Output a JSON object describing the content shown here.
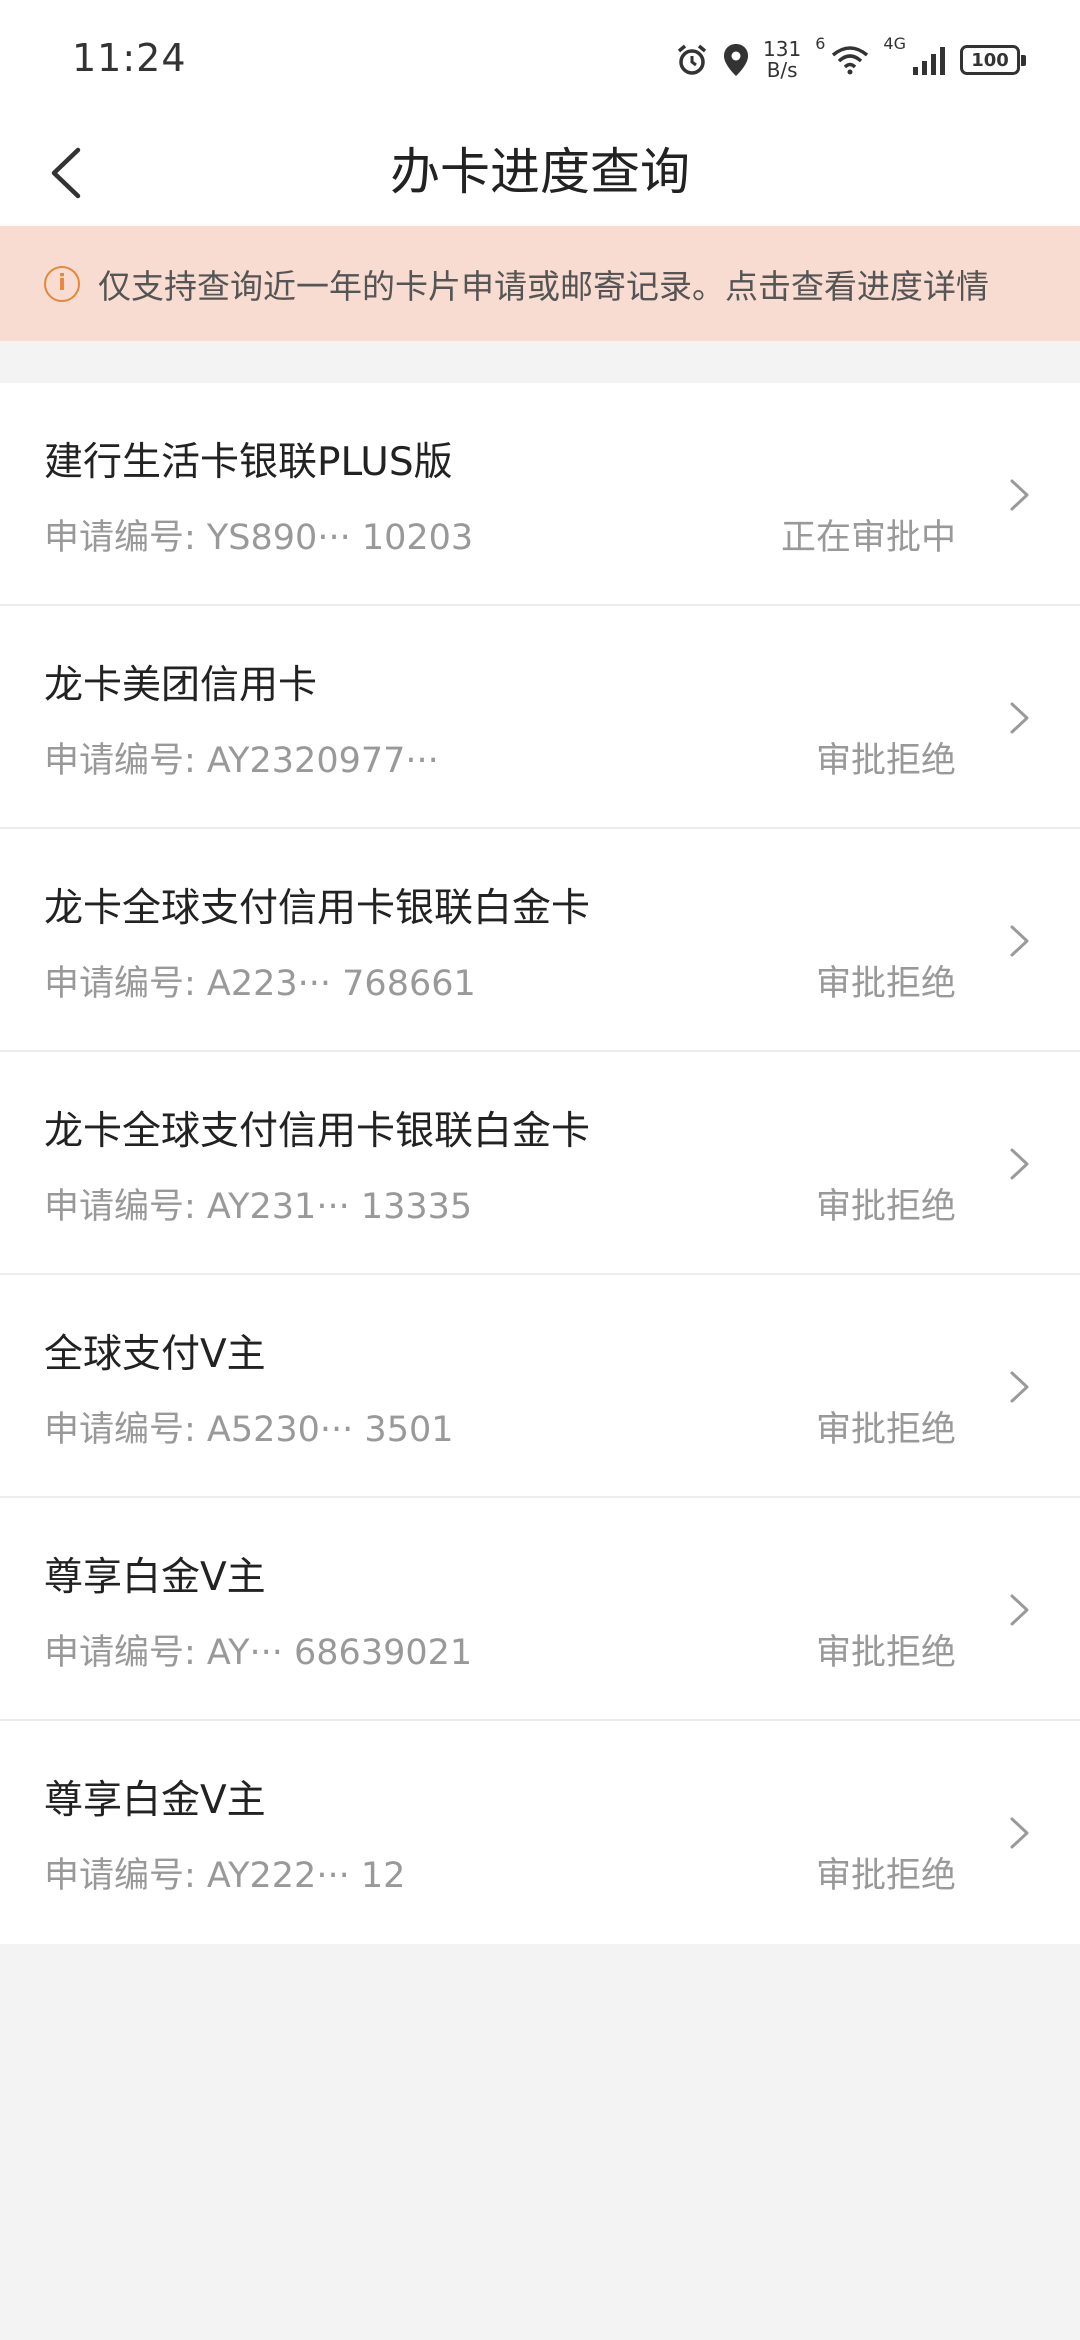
{
  "status_bar": {
    "time": "11:24",
    "net_speed_value": "131",
    "net_speed_unit": "B/s",
    "wifi_label": "6",
    "signal_label": "4G",
    "battery": "100"
  },
  "nav": {
    "title": "办卡进度查询"
  },
  "notice": {
    "icon": "info-icon",
    "icon_glyph": "i",
    "text": "仅支持查询近一年的卡片申请或邮寄记录。点击查看进度详情",
    "color": "#e7873a"
  },
  "applications": [
    {
      "title": "建行生活卡银联PLUS版",
      "number": "申请编号: YS890··· 10203",
      "status": "正在审批中"
    },
    {
      "title": "龙卡美团信用卡",
      "number": "申请编号: AY2320977···",
      "status": "审批拒绝"
    },
    {
      "title": "龙卡全球支付信用卡银联白金卡",
      "number": "申请编号: A223··· 768661",
      "status": "审批拒绝"
    },
    {
      "title": "龙卡全球支付信用卡银联白金卡",
      "number": "申请编号: AY231··· 13335",
      "status": "审批拒绝"
    },
    {
      "title": "全球支付V主",
      "number": "申请编号: A5230··· 3501",
      "status": "审批拒绝"
    },
    {
      "title": "尊享白金V主",
      "number": "申请编号: AY··· 68639021",
      "status": "审批拒绝"
    },
    {
      "title": "尊享白金V主",
      "number": "申请编号: AY222··· 12",
      "status": "审批拒绝"
    }
  ]
}
